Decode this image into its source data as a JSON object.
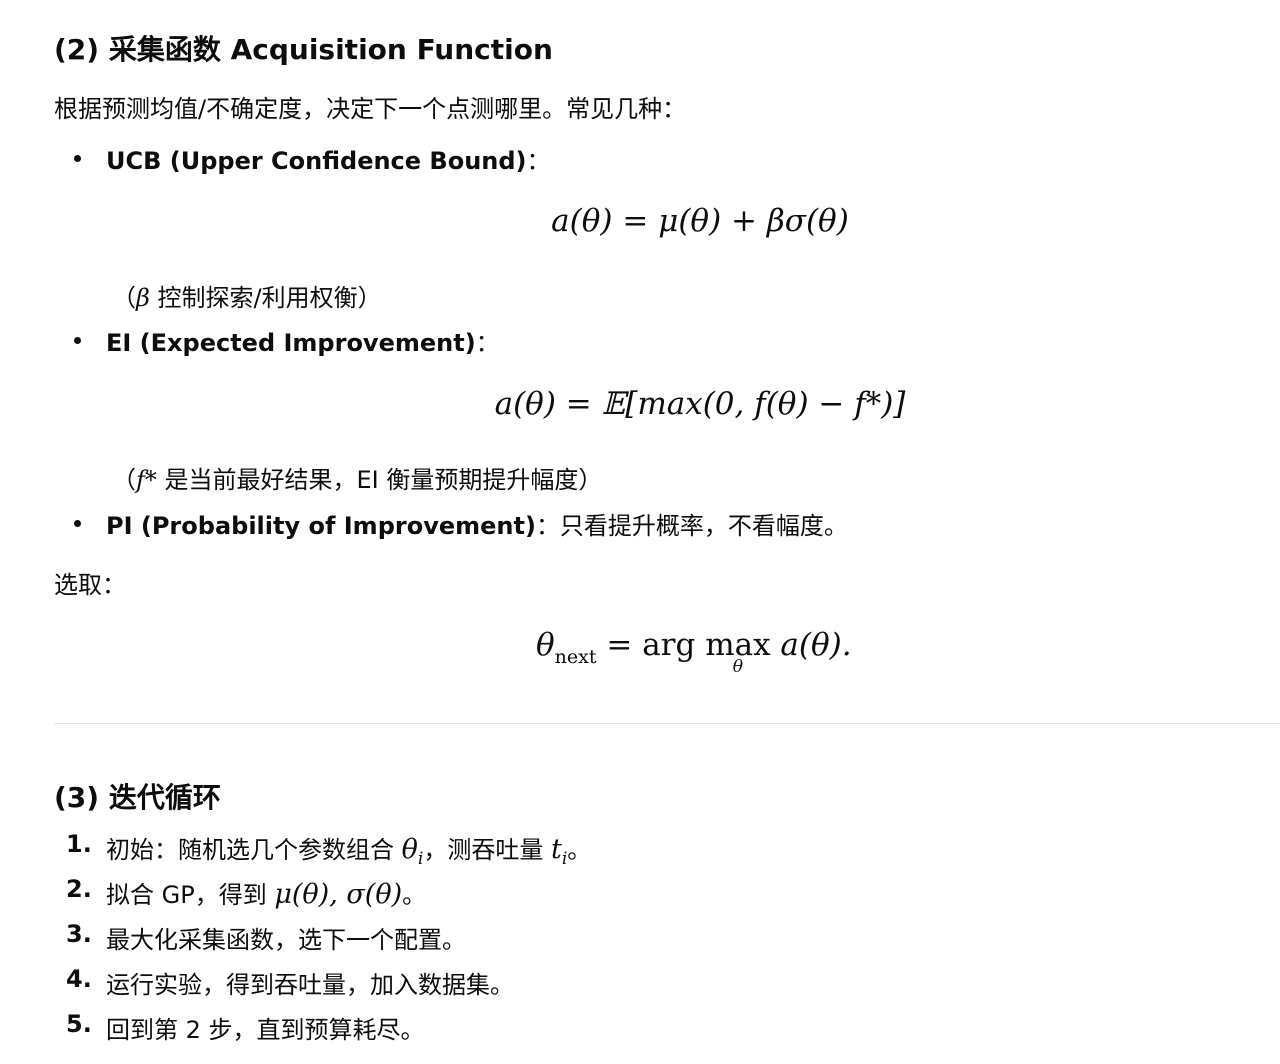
{
  "section2": {
    "heading": "(2) 采集函数 Acquisition Function",
    "intro": "根据预测均值/不确定度，决定下一个点测哪里。常见几种：",
    "ucb": {
      "label": "UCB (Upper Confidence Bound)",
      "colon": "：",
      "formula": "a(θ) = μ(θ) + βσ(θ)",
      "note_open": "（",
      "note_sym": "β",
      "note_text": " 控制探索/利用权衡）"
    },
    "ei": {
      "label": "EI (Expected Improvement)",
      "colon": "：",
      "formula": "a(θ) = 𝔼[max(0, f(θ) − f*)]",
      "note_open": "（",
      "note_sym": "f*",
      "note_text": " 是当前最好结果，EI 衡量预期提升幅度）"
    },
    "pi": {
      "label": "PI (Probability of Improvement)",
      "text": "：只看提升概率，不看幅度。"
    },
    "select_label": "选取：",
    "select_formula": {
      "lhs": "θ",
      "lhs_sub": "next",
      "rhs_pre": "= arg ",
      "max": "max",
      "max_sub": "θ",
      "rhs_post": " a(θ)."
    }
  },
  "section3": {
    "heading": "(3) 迭代循环",
    "steps": [
      {
        "num": "1.",
        "pre": "初始：随机选几个参数组合 ",
        "m1": "θ",
        "m1_sub": "i",
        "mid": "，测吞吐量 ",
        "m2": "t",
        "m2_sub": "i",
        "post": "。"
      },
      {
        "num": "2.",
        "pre": "拟合 GP，得到 ",
        "m1": "μ(θ), σ(θ)",
        "post": "。"
      },
      {
        "num": "3.",
        "text": "最大化采集函数，选下一个配置。"
      },
      {
        "num": "4.",
        "text": "运行实验，得到吞吐量，加入数据集。"
      },
      {
        "num": "5.",
        "text": "回到第 2 步，直到预算耗尽。"
      }
    ]
  }
}
